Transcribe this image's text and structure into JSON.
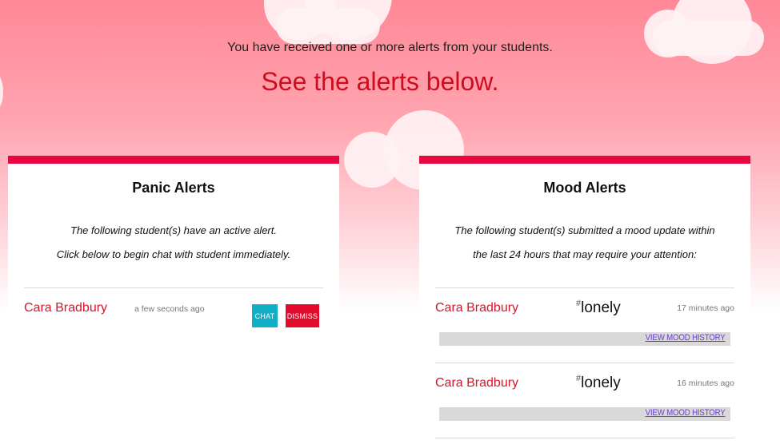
{
  "header": {
    "message": "You have received one or more alerts from your students.",
    "title": "See the alerts below."
  },
  "panic": {
    "title": "Panic Alerts",
    "desc_line1": "The following student(s) have an active alert.",
    "desc_line2": "Click below to begin chat with student immediately.",
    "alerts": [
      {
        "student": "Cara Bradbury",
        "time": "a few seconds ago",
        "chat_label": "CHAT",
        "dismiss_label": "DISMISS"
      }
    ]
  },
  "mood": {
    "title": "Mood Alerts",
    "desc_line1": "The following student(s) submitted a mood update within",
    "desc_line2": "the last 24 hours that may require your attention:",
    "alerts": [
      {
        "student": "Cara Bradbury",
        "hash": "#",
        "mood": "lonely",
        "time": "17 minutes ago",
        "history_label": "VIEW MOOD HISTORY"
      },
      {
        "student": "Cara Bradbury",
        "hash": "#",
        "mood": "lonely",
        "time": "16 minutes ago",
        "history_label": "VIEW MOOD HISTORY"
      }
    ]
  },
  "colors": {
    "accent": "#e8083f",
    "title_red": "#cc0d1e",
    "student_red": "#d8152b",
    "chat_button": "#10afc7",
    "dismiss_button": "#e20b2c",
    "link_purple": "#6b3ad8"
  }
}
